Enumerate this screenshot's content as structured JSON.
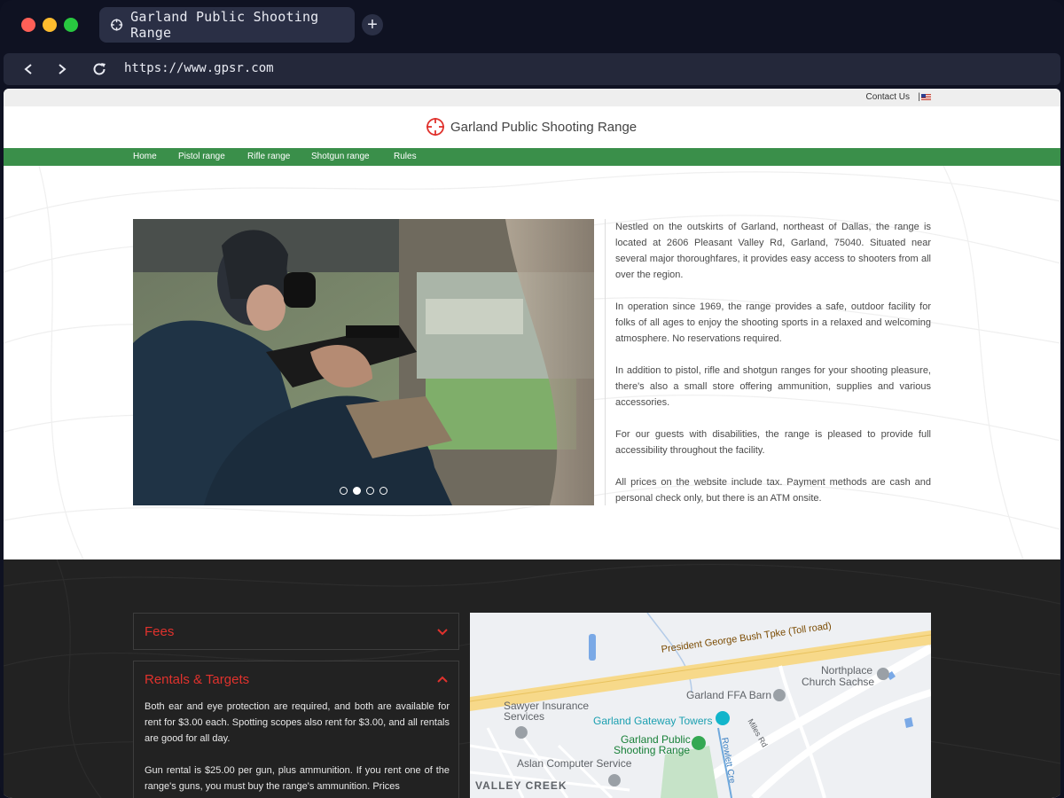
{
  "browser": {
    "tab_title": "Garland Public Shooting Range",
    "new_tab_label": "+",
    "url": "https://www.gpsr.com"
  },
  "utility": {
    "contact_label": "Contact Us",
    "separator": "|"
  },
  "site": {
    "name": "Garland Public Shooting Range",
    "accent_color": "#3a8f4a",
    "highlight_color": "#e0322d"
  },
  "nav": {
    "items": [
      "Home",
      "Pistol range",
      "Rifle range",
      "Shotgun range",
      "Rules"
    ]
  },
  "carousel": {
    "slide_count": 4,
    "active_index": 1
  },
  "intro": {
    "paragraphs": [
      "Nestled on the outskirts of Garland, northeast of Dallas, the range is located at 2606 Pleasant Valley Rd, Garland, 75040. Situated near several major thoroughfares, it provides easy access to shooters from all over the region.",
      "In operation since 1969, the range provides a safe, outdoor facility for folks of all ages to enjoy the shooting sports in a relaxed and welcoming atmosphere. No reservations required.",
      "In addition to pistol, rifle and shotgun ranges for your shooting pleasure, there's also a small store offering ammunition, supplies and various accessories.",
      "For our guests with disabilities, the range is pleased to provide full accessibility throughout the facility.",
      "All prices on the website include tax. Payment methods are cash and personal check only, but there is an ATM onsite."
    ]
  },
  "accordion": {
    "fees": {
      "title": "Fees",
      "expanded": false
    },
    "rentals": {
      "title": "Rentals & Targets",
      "expanded": true,
      "paragraphs": [
        "Both ear and eye protection are required, and both are available for rent for $3.00 each. Spotting scopes also rent for $3.00, and all rentals are good for all day.",
        "Gun rental is $25.00 per gun, plus ammunition. If you rent one of the range's guns, you must buy the range's ammunition. Prices"
      ]
    }
  },
  "map": {
    "labels": {
      "toll_road": "President George Bush Tpke (Toll road)",
      "northplace": "Northplace",
      "church": "Church Sachse",
      "ffa": "Garland FFA Barn",
      "sawyer1": "Sawyer Insurance",
      "sawyer2": "Services",
      "gateway": "Garland Gateway Towers",
      "range1": "Garland Public",
      "range2": "Shooting Range",
      "miles": "Miles Rd",
      "aslan": "Aslan Computer Service",
      "rowlett": "Rowlett Cre",
      "valley": "VALLEY CREEK"
    }
  }
}
